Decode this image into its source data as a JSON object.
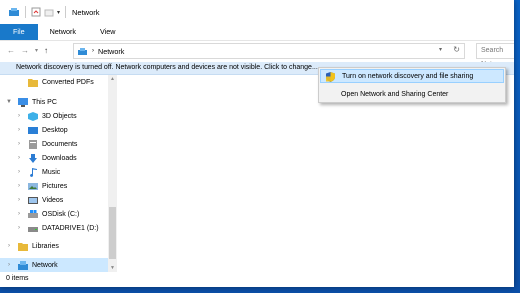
{
  "window": {
    "title": "Network"
  },
  "ribbon": {
    "tabs": [
      "File",
      "Network",
      "View"
    ]
  },
  "address": {
    "path": "Network",
    "search_placeholder": "Search Netw"
  },
  "infobar": {
    "message": "Network discovery is turned off. Network computers and devices are not visible. Click to change..."
  },
  "context_menu": {
    "items": [
      "Turn on network discovery and file sharing",
      "Open Network and Sharing Center"
    ]
  },
  "tree": {
    "converted": "Converted PDFs",
    "thispc": "This PC",
    "items": [
      "3D Objects",
      "Desktop",
      "Documents",
      "Downloads",
      "Music",
      "Pictures",
      "Videos",
      "OSDisk (C:)",
      "DATADRIVE1 (D:)"
    ],
    "libraries": "Libraries",
    "network": "Network"
  },
  "status": {
    "count": "0 items"
  },
  "colors": {
    "accent": "#1979ca",
    "selection": "#cce8ff",
    "menu_highlight": "#cde8ff"
  }
}
